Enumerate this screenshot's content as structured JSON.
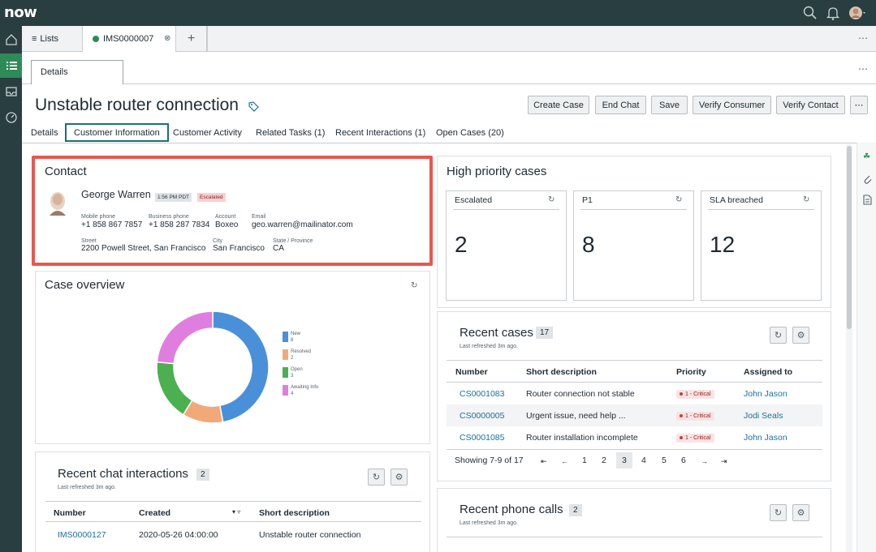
{
  "header": {
    "logo": "now"
  },
  "tabs": [
    {
      "label": "Lists"
    },
    {
      "label": "IMS0000007"
    }
  ],
  "subtab": {
    "label": "Details"
  },
  "page_title": "Unstable router connection",
  "buttons": [
    "Create Case",
    "End Chat",
    "Save",
    "Verify Consumer",
    "Verify Contact"
  ],
  "nav_tabs": [
    "Details",
    "Customer Information",
    "Customer Activity",
    "Related Tasks (1)",
    "Recent Interactions (1)",
    "Open Cases (20)"
  ],
  "contact": {
    "title": "Contact",
    "name": "George Warren",
    "time_badge": "1:56 PM PDT",
    "status_badge": "Escalated",
    "mobile_label": "Mobile phone",
    "mobile": "+1 858 867 7857",
    "business_label": "Business phone",
    "business": "+1 858 287 7834",
    "account_label": "Account",
    "account": "Boxeo",
    "email_label": "Email",
    "email": "geo.warren@mailinator.com",
    "street_label": "Street",
    "street": "2200 Powell Street, San Francisco",
    "city_label": "City",
    "city": "San Francisco",
    "state_label": "State / Province",
    "state": "CA"
  },
  "case_overview": {
    "title": "Case overview",
    "legend": [
      {
        "name": "New",
        "value": "8",
        "color": "#4a90d9"
      },
      {
        "name": "Resolved",
        "value": "2",
        "color": "#f2a97a"
      },
      {
        "name": "Open",
        "value": "3",
        "color": "#4caf50"
      },
      {
        "name": "Awaiting Info",
        "value": "4",
        "color": "#e07ee0"
      }
    ]
  },
  "chart_data": {
    "type": "pie",
    "categories": [
      "New",
      "Resolved",
      "Open",
      "Awaiting Info"
    ],
    "values": [
      8,
      2,
      3,
      4
    ],
    "title": "Case overview"
  },
  "high_priority": {
    "title": "High priority cases",
    "kpis": [
      {
        "label": "Escalated",
        "value": "2"
      },
      {
        "label": "P1",
        "value": "8"
      },
      {
        "label": "SLA breached",
        "value": "12"
      }
    ]
  },
  "recent_cases": {
    "title": "Recent cases",
    "count": "17",
    "refreshed": "Last refreshed 3m ago.",
    "columns": [
      "Number",
      "Short description",
      "Priority",
      "Assigned to"
    ],
    "rows": [
      {
        "number": "CS0001083",
        "desc": "Router connection not stable",
        "priority": "1 - Critical",
        "assigned": "John Jason"
      },
      {
        "number": "CS0000005",
        "desc": "Urgent issue, need help ...",
        "priority": "1 - Critical",
        "assigned": "Jodi Seals"
      },
      {
        "number": "CS0001085",
        "desc": "Router installation incomplete",
        "priority": "1 - Critical",
        "assigned": "John Jason"
      }
    ],
    "showing": "Showing 7-9 of 17",
    "pages": [
      "1",
      "2",
      "3",
      "4",
      "5",
      "6"
    ]
  },
  "recent_chats": {
    "title": "Recent chat interactions",
    "count": "2",
    "refreshed": "Last refreshed 3m ago.",
    "columns": [
      "Number",
      "Created",
      "Short description"
    ],
    "rows": [
      {
        "number": "IMS0000127",
        "created": "2020-05-26 04:00:00",
        "desc": "Unstable router connection"
      }
    ]
  },
  "recent_phone": {
    "title": "Recent phone calls",
    "count": "2",
    "refreshed": "Last refreshed 3m ago."
  }
}
